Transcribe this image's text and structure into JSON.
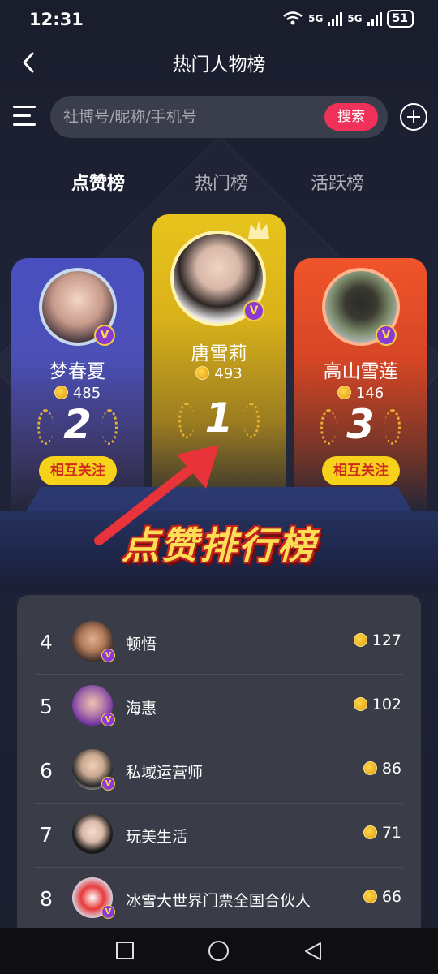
{
  "status": {
    "time": "12:31",
    "net1": "5G",
    "net2": "5G",
    "battery": "51"
  },
  "header": {
    "title": "热门人物榜"
  },
  "search": {
    "placeholder": "社博号/昵称/手机号",
    "button": "搜索"
  },
  "tabs": [
    {
      "label": "点赞榜",
      "active": true
    },
    {
      "label": "热门榜",
      "active": false
    },
    {
      "label": "活跃榜",
      "active": false
    }
  ],
  "podium": [
    {
      "rank": "1",
      "name": "唐雪莉",
      "score": "493",
      "badge": "V",
      "color": "#e8c41c"
    },
    {
      "rank": "2",
      "name": "梦春夏",
      "score": "485",
      "badge": "V",
      "follow": "相互关注",
      "color": "#4a4fc0"
    },
    {
      "rank": "3",
      "name": "高山雪莲",
      "score": "146",
      "badge": "V",
      "follow": "相互关注",
      "color": "#f0542a"
    }
  ],
  "banner": {
    "text": "点赞排行榜"
  },
  "list": [
    {
      "rank": "4",
      "name": "顿悟",
      "score": "127"
    },
    {
      "rank": "5",
      "name": "海惠",
      "score": "102"
    },
    {
      "rank": "6",
      "name": "私域运营师",
      "score": "86"
    },
    {
      "rank": "7",
      "name": "玩美生活",
      "score": "71"
    },
    {
      "rank": "8",
      "name": "冰雪大世界门票全国合伙人",
      "score": "66"
    }
  ],
  "badge_letter": "V",
  "colors": {
    "accent": "#f0325a",
    "gold": "#f7d21a",
    "follow_text": "#d02a20",
    "annotation_arrow": "#e8333a"
  },
  "icons": [
    "back-icon",
    "menu-icon",
    "plus-icon",
    "coin-icon",
    "v-badge-icon",
    "nav-square-icon",
    "nav-home-icon",
    "nav-back-icon",
    "annotation-arrow"
  ]
}
